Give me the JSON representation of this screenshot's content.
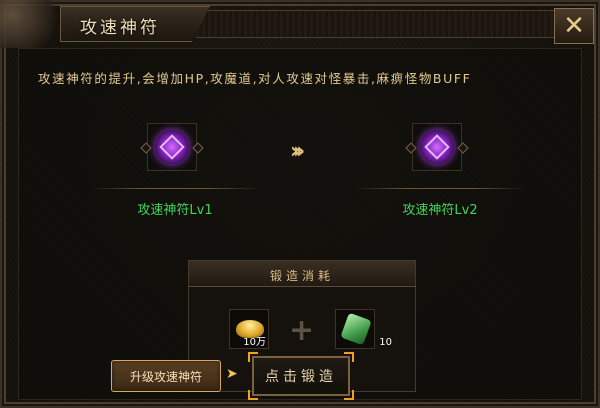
{
  "window": {
    "title": "攻速神符",
    "close_icon": "close-x-icon"
  },
  "description": "攻速神符的提升,会增加HP,攻魔道,对人攻速对怪暴击,麻痹怪物BUFF",
  "upgrade": {
    "current": {
      "name": "攻速神符Lv1",
      "icon": "purple-rune-icon"
    },
    "next": {
      "name": "攻速神符Lv2",
      "icon": "purple-rune-icon"
    },
    "arrow_icon": "double-chevron-right-icon"
  },
  "cost": {
    "title": "锻造消耗",
    "items": [
      {
        "icon": "gold-ingot-icon",
        "quantity": "10万"
      },
      {
        "icon": "jade-stone-icon",
        "quantity": "10"
      }
    ],
    "plus_icon": "plus-icon"
  },
  "buttons": {
    "upgrade_label": "升级攻速神符",
    "forge_label": "点击锻造"
  },
  "colors": {
    "item_name": "#3fd35a",
    "description": "#e2c890",
    "accent": "#f2a020"
  }
}
